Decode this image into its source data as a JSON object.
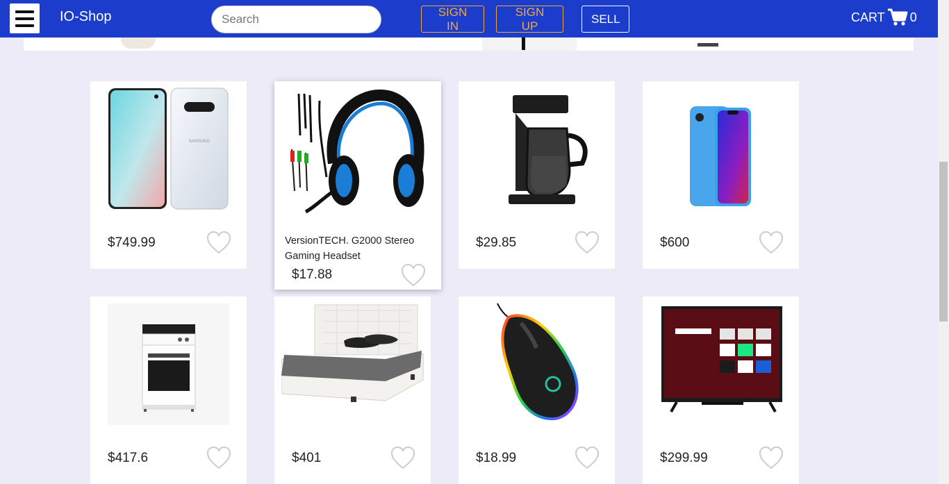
{
  "navbar": {
    "brand": "IO-Shop",
    "search_placeholder": "Search",
    "sign_in": "SIGN IN",
    "sign_up": "SIGN UP",
    "sell": "SELL",
    "cart_label": "CART",
    "cart_count": "0",
    "icons": {
      "menu": "hamburger-icon",
      "cart": "shopping-cart-icon"
    },
    "colors": {
      "background": "#1c3dcc",
      "accent": "#f2a93b"
    }
  },
  "products": [
    {
      "name": "",
      "price": "$749.99",
      "image": "samsung-galaxy-phone"
    },
    {
      "name": "VersionTECH. G2000 Stereo Gaming Headset",
      "price": "$17.88",
      "image": "gaming-headset"
    },
    {
      "name": "",
      "price": "$29.85",
      "image": "coffee-maker"
    },
    {
      "name": "",
      "price": "$600",
      "image": "iphone-xr-blue"
    },
    {
      "name": "",
      "price": "$417.6",
      "image": "electric-stove"
    },
    {
      "name": "",
      "price": "$401",
      "image": "bed"
    },
    {
      "name": "",
      "price": "$18.99",
      "image": "gaming-mouse"
    },
    {
      "name": "",
      "price": "$299.99",
      "image": "tcl-roku-tv"
    }
  ],
  "icons": {
    "favorite": "heart-icon"
  }
}
